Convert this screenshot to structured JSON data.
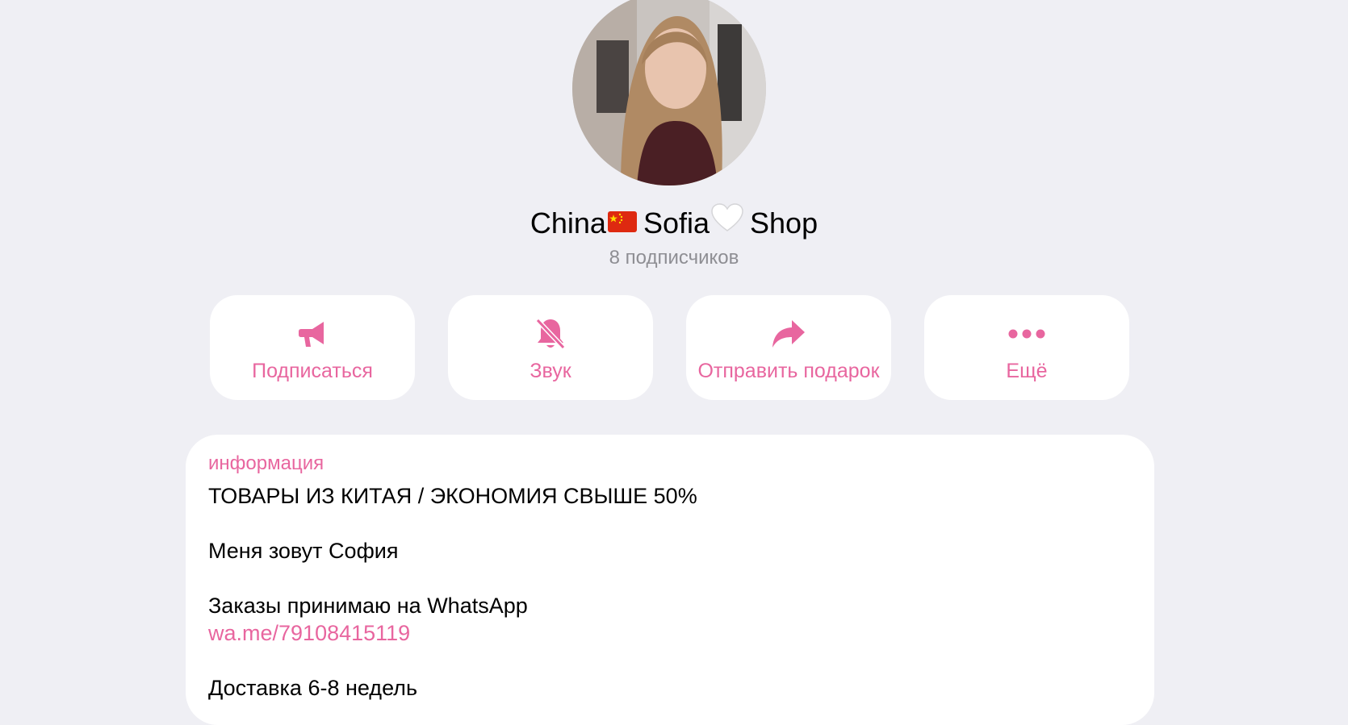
{
  "channel": {
    "name_part1": "China",
    "name_part2": "Sofia",
    "name_part3": "Shop",
    "flag_icon": "china-flag-emoji",
    "heart_icon": "white-heart-emoji",
    "subscribers": "8 подписчиков"
  },
  "actions": [
    {
      "label": "Подписаться",
      "icon": "megaphone-icon"
    },
    {
      "label": "Звук",
      "icon": "bell-slash-icon"
    },
    {
      "label": "Отправить подарок",
      "icon": "share-arrow-icon"
    },
    {
      "label": "Ещё",
      "icon": "ellipsis-icon"
    }
  ],
  "info": {
    "header": "информация",
    "line1": "ТОВАРЫ ИЗ КИТАЯ / ЭКОНОМИЯ СВЫШЕ 50%",
    "line2": "Меня зовут София",
    "line3": "Заказы принимаю на WhatsApp",
    "link": "wa.me/79108415119",
    "line4": "Доставка 6-8 недель"
  },
  "colors": {
    "accent": "#e8669f",
    "background": "#efeff4",
    "card": "#ffffff",
    "secondary_text": "#8e8e93"
  }
}
